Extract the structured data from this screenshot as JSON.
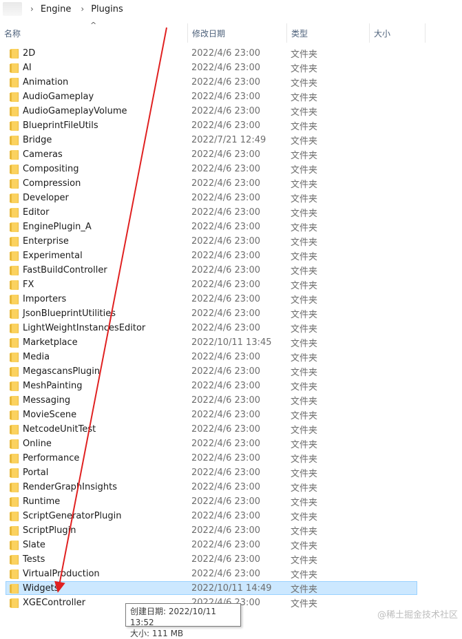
{
  "breadcrumb": {
    "items": [
      "Engine",
      "Plugins"
    ],
    "separator": "›"
  },
  "columns": {
    "name": "名称",
    "modified": "修改日期",
    "type": "类型",
    "size": "大小"
  },
  "folder_icon_color": "#fbd25f",
  "files": [
    {
      "name": "2D",
      "modified": "2022/4/6 23:00",
      "type": "文件夹"
    },
    {
      "name": "AI",
      "modified": "2022/4/6 23:00",
      "type": "文件夹"
    },
    {
      "name": "Animation",
      "modified": "2022/4/6 23:00",
      "type": "文件夹"
    },
    {
      "name": "AudioGameplay",
      "modified": "2022/4/6 23:00",
      "type": "文件夹"
    },
    {
      "name": "AudioGameplayVolume",
      "modified": "2022/4/6 23:00",
      "type": "文件夹"
    },
    {
      "name": "BlueprintFileUtils",
      "modified": "2022/4/6 23:00",
      "type": "文件夹"
    },
    {
      "name": "Bridge",
      "modified": "2022/7/21 12:49",
      "type": "文件夹"
    },
    {
      "name": "Cameras",
      "modified": "2022/4/6 23:00",
      "type": "文件夹"
    },
    {
      "name": "Compositing",
      "modified": "2022/4/6 23:00",
      "type": "文件夹"
    },
    {
      "name": "Compression",
      "modified": "2022/4/6 23:00",
      "type": "文件夹"
    },
    {
      "name": "Developer",
      "modified": "2022/4/6 23:00",
      "type": "文件夹"
    },
    {
      "name": "Editor",
      "modified": "2022/4/6 23:00",
      "type": "文件夹"
    },
    {
      "name": "EnginePlugin_A",
      "modified": "2022/4/6 23:00",
      "type": "文件夹"
    },
    {
      "name": "Enterprise",
      "modified": "2022/4/6 23:00",
      "type": "文件夹"
    },
    {
      "name": "Experimental",
      "modified": "2022/4/6 23:00",
      "type": "文件夹"
    },
    {
      "name": "FastBuildController",
      "modified": "2022/4/6 23:00",
      "type": "文件夹"
    },
    {
      "name": "FX",
      "modified": "2022/4/6 23:00",
      "type": "文件夹"
    },
    {
      "name": "Importers",
      "modified": "2022/4/6 23:00",
      "type": "文件夹"
    },
    {
      "name": "JsonBlueprintUtilities",
      "modified": "2022/4/6 23:00",
      "type": "文件夹"
    },
    {
      "name": "LightWeightInstancesEditor",
      "modified": "2022/4/6 23:00",
      "type": "文件夹"
    },
    {
      "name": "Marketplace",
      "modified": "2022/10/11 13:45",
      "type": "文件夹"
    },
    {
      "name": "Media",
      "modified": "2022/4/6 23:00",
      "type": "文件夹"
    },
    {
      "name": "MegascansPlugin",
      "modified": "2022/4/6 23:00",
      "type": "文件夹"
    },
    {
      "name": "MeshPainting",
      "modified": "2022/4/6 23:00",
      "type": "文件夹"
    },
    {
      "name": "Messaging",
      "modified": "2022/4/6 23:00",
      "type": "文件夹"
    },
    {
      "name": "MovieScene",
      "modified": "2022/4/6 23:00",
      "type": "文件夹"
    },
    {
      "name": "NetcodeUnitTest",
      "modified": "2022/4/6 23:00",
      "type": "文件夹"
    },
    {
      "name": "Online",
      "modified": "2022/4/6 23:00",
      "type": "文件夹"
    },
    {
      "name": "Performance",
      "modified": "2022/4/6 23:00",
      "type": "文件夹"
    },
    {
      "name": "Portal",
      "modified": "2022/4/6 23:00",
      "type": "文件夹"
    },
    {
      "name": "RenderGraphInsights",
      "modified": "2022/4/6 23:00",
      "type": "文件夹"
    },
    {
      "name": "Runtime",
      "modified": "2022/4/6 23:00",
      "type": "文件夹"
    },
    {
      "name": "ScriptGeneratorPlugin",
      "modified": "2022/4/6 23:00",
      "type": "文件夹"
    },
    {
      "name": "ScriptPlugin",
      "modified": "2022/4/6 23:00",
      "type": "文件夹"
    },
    {
      "name": "Slate",
      "modified": "2022/4/6 23:00",
      "type": "文件夹"
    },
    {
      "name": "Tests",
      "modified": "2022/4/6 23:00",
      "type": "文件夹"
    },
    {
      "name": "VirtualProduction",
      "modified": "2022/4/6 23:00",
      "type": "文件夹"
    },
    {
      "name": "Widgets",
      "modified": "2022/10/11 14:49",
      "type": "文件夹",
      "selected": true
    },
    {
      "name": "XGEController",
      "modified": "2022/4/6 23:00",
      "type": "文件夹"
    }
  ],
  "tooltip": {
    "line1": "创建日期: 2022/10/11 13:52",
    "line2": "大小: 111 MB"
  },
  "annotation_arrow_color": "#e02020",
  "watermark": "@稀土掘金技术社区"
}
